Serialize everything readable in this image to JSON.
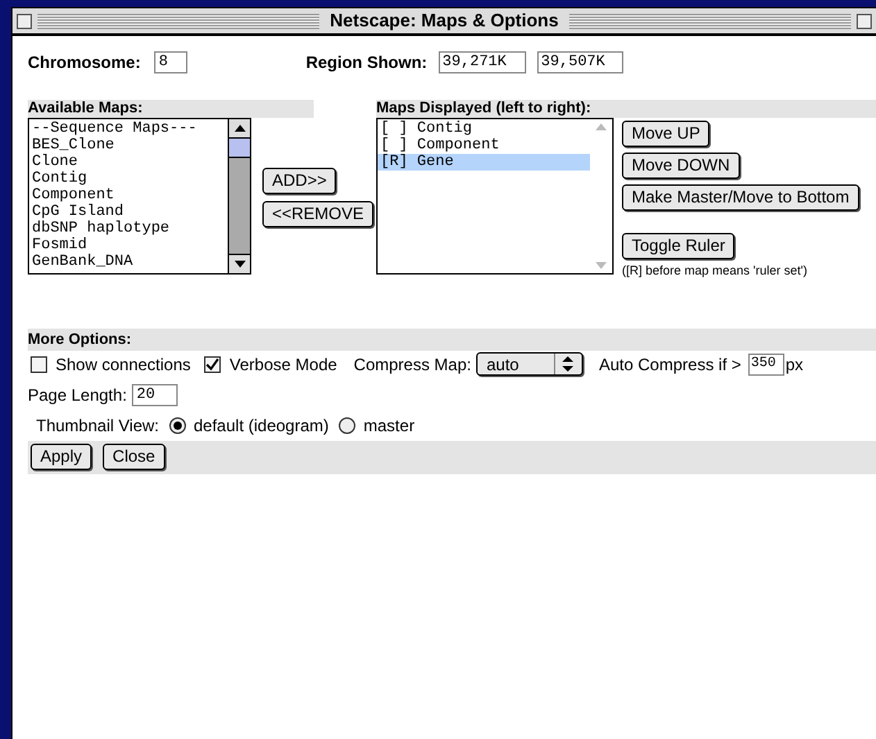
{
  "window": {
    "title": "Netscape: Maps & Options"
  },
  "chromosome": {
    "label": "Chromosome:",
    "value": "8"
  },
  "region": {
    "label": "Region Shown:",
    "start": "39,271K",
    "end": "39,507K"
  },
  "available_maps": {
    "heading": "Available Maps:",
    "items": [
      "--Sequence Maps---",
      "BES_Clone",
      "Clone",
      "Contig",
      "Component",
      "CpG Island",
      "dbSNP haplotype",
      "Fosmid",
      "GenBank_DNA"
    ]
  },
  "transfer_buttons": [
    "ADD>>",
    "<<REMOVE"
  ],
  "displayed_maps": {
    "heading": "Maps Displayed (left to right):",
    "items": [
      {
        "label": "[ ] Contig",
        "selected": false
      },
      {
        "label": "[ ] Component",
        "selected": false
      },
      {
        "label": "[R] Gene",
        "selected": true
      }
    ]
  },
  "order_buttons": [
    "Move UP",
    "Move DOWN",
    "Make Master/Move to Bottom"
  ],
  "ruler_button": "Toggle Ruler",
  "ruler_note": "([R] before map means 'ruler set')",
  "more_options": {
    "heading": "More Options:",
    "checkboxes": [
      {
        "label": "Show connections",
        "checked": false
      },
      {
        "label": "Verbose Mode",
        "checked": true
      }
    ],
    "compress_map": {
      "label": "Compress Map:",
      "value": "auto"
    },
    "auto_compress": {
      "label": "Auto Compress if >",
      "value": "350",
      "unit": "px"
    },
    "page_length": {
      "label": "Page Length:",
      "value": "20"
    },
    "thumbnail": {
      "label": "Thumbnail View:",
      "options": [
        {
          "label": "default (ideogram)",
          "selected": true
        },
        {
          "label": "master",
          "selected": false
        }
      ]
    }
  },
  "actions": [
    "Apply",
    "Close"
  ]
}
